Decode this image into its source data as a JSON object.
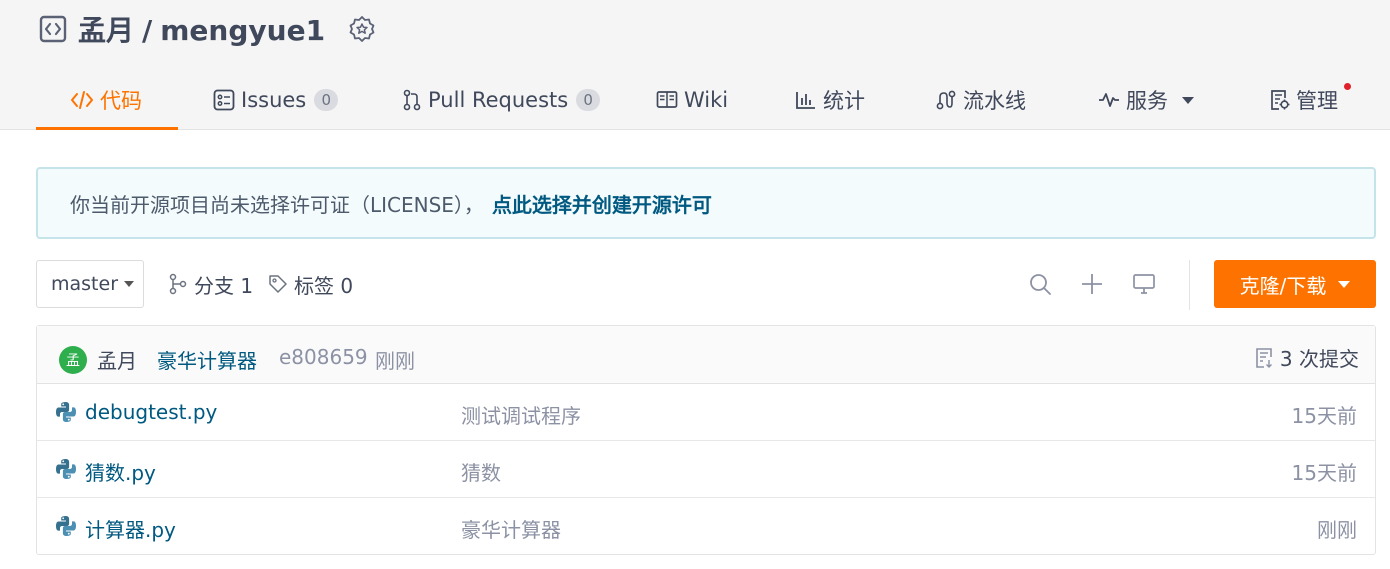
{
  "repo": {
    "owner": "孟月",
    "separator": "/",
    "name": "mengyue1"
  },
  "nav": {
    "tabs": [
      {
        "label": "代码",
        "icon": "code-icon",
        "active": true
      },
      {
        "label": "Issues",
        "icon": "issues-icon",
        "count": "0"
      },
      {
        "label": "Pull Requests",
        "icon": "pull-request-icon",
        "count": "0"
      },
      {
        "label": "Wiki",
        "icon": "book-icon"
      },
      {
        "label": "统计",
        "icon": "bar-chart-icon"
      },
      {
        "label": "流水线",
        "icon": "pipeline-icon"
      },
      {
        "label": "服务",
        "icon": "pulse-icon"
      },
      {
        "label": "管理",
        "icon": "manage-icon"
      }
    ]
  },
  "license": {
    "message": "你当前开源项目尚未选择许可证（LICENSE），",
    "link": "点此选择并创建开源许可"
  },
  "toolbar": {
    "branch": "master",
    "branches_label": "分支 1",
    "tags_label": "标签 0",
    "clone_label": "克隆/下载"
  },
  "commit": {
    "avatar_text": "孟",
    "author": "孟月",
    "message": "豪华计算器",
    "hash": "e808659",
    "time": "刚刚",
    "commits_label": "3 次提交"
  },
  "files": [
    {
      "name": "debugtest.py",
      "message": "测试调试程序",
      "time": "15天前",
      "icon": "python-icon"
    },
    {
      "name": "猜数.py",
      "message": "猜数",
      "time": "15天前",
      "icon": "python-icon"
    },
    {
      "name": "计算器.py",
      "message": "豪华计算器",
      "time": "刚刚",
      "icon": "python-icon"
    }
  ],
  "colors": {
    "accent": "#fe7300",
    "link": "#005980",
    "avatar": "#2eae4d",
    "notification": "#e0202b"
  }
}
